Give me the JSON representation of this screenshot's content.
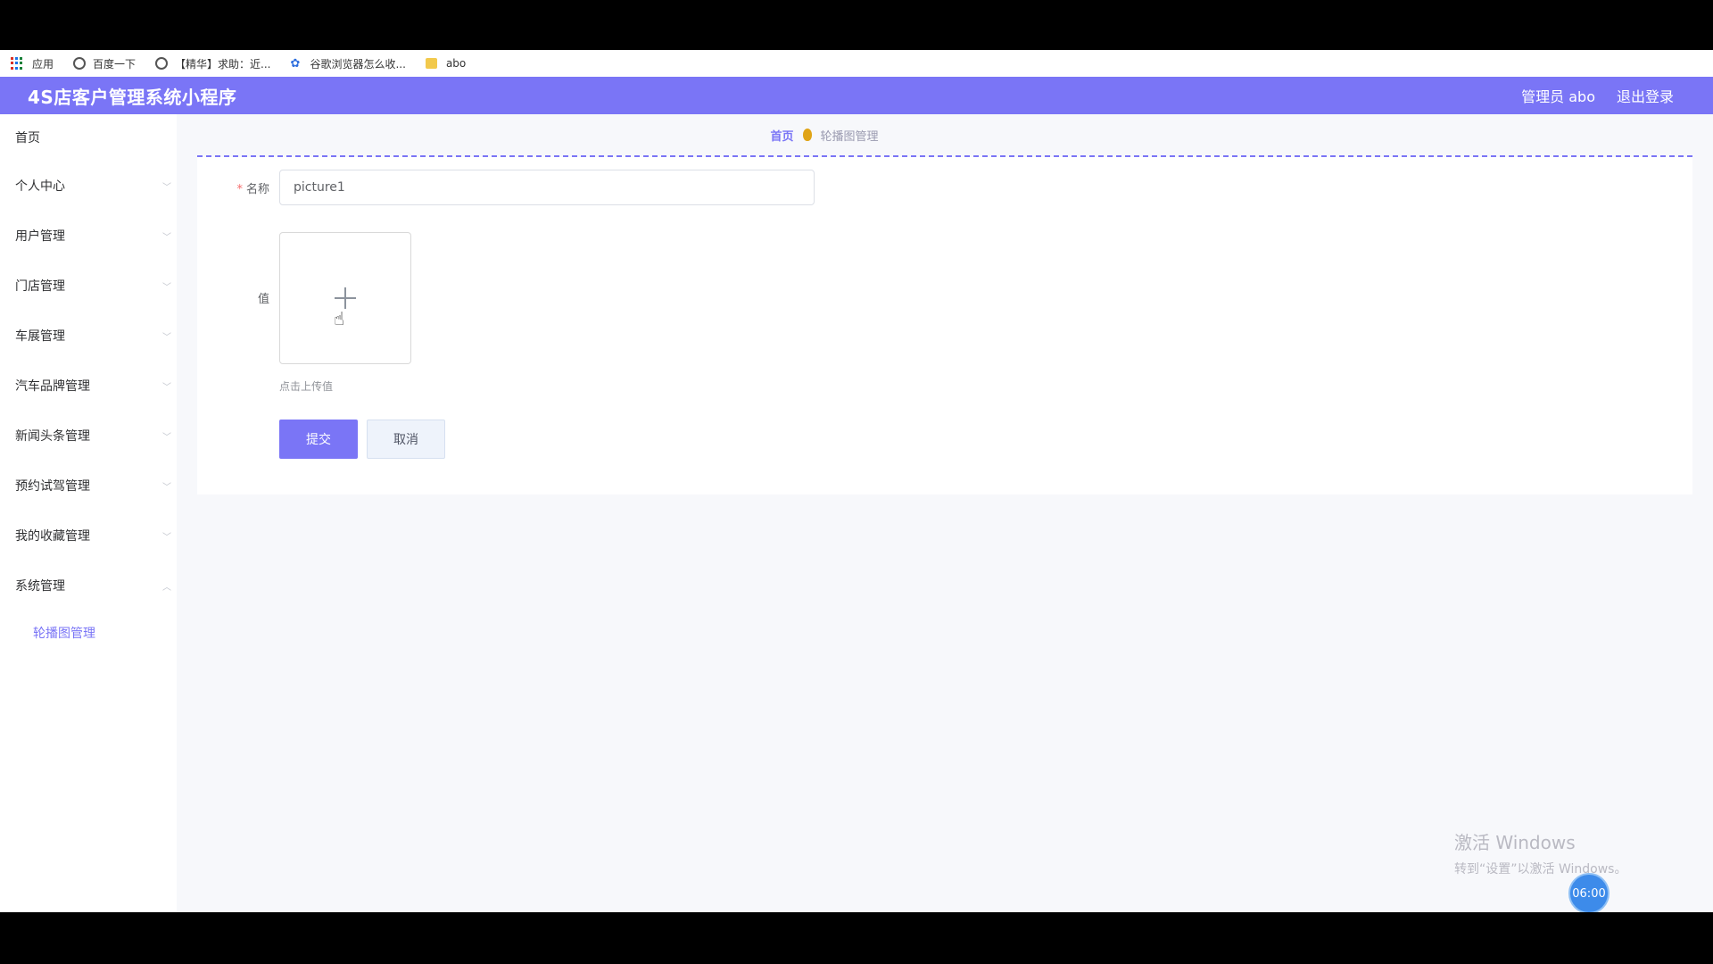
{
  "bookmarks": {
    "items": [
      {
        "label": "应用",
        "icon": "apps-icon"
      },
      {
        "label": "百度一下",
        "icon": "globe-icon"
      },
      {
        "label": "【精华】求助：近...",
        "icon": "globe-icon"
      },
      {
        "label": "谷歌浏览器怎么收...",
        "icon": "paw-icon"
      },
      {
        "label": "abo",
        "icon": "folder-icon"
      }
    ]
  },
  "header": {
    "title": "4S店客户管理系统小程序",
    "user": "管理员 abo",
    "logout": "退出登录",
    "color": "#7a75f6"
  },
  "sidebar": {
    "items": [
      {
        "label": "首页"
      },
      {
        "label": "个人中心"
      },
      {
        "label": "用户管理"
      },
      {
        "label": "门店管理"
      },
      {
        "label": "车展管理"
      },
      {
        "label": "汽车品牌管理"
      },
      {
        "label": "新闻头条管理"
      },
      {
        "label": "预约试驾管理"
      },
      {
        "label": "我的收藏管理"
      },
      {
        "label": "系统管理"
      }
    ],
    "sub_item": "轮播图管理"
  },
  "breadcrumb": {
    "home": "首页",
    "current": "轮播图管理"
  },
  "form": {
    "name_label": "名称",
    "name_value": "picture1",
    "value_label": "值",
    "upload_hint": "点击上传值",
    "submit": "提交",
    "cancel": "取消"
  },
  "overlay": {
    "watermark_title": "激活 Windows",
    "watermark_sub": "转到“设置”以激活 Windows。",
    "timer": "06:00"
  }
}
